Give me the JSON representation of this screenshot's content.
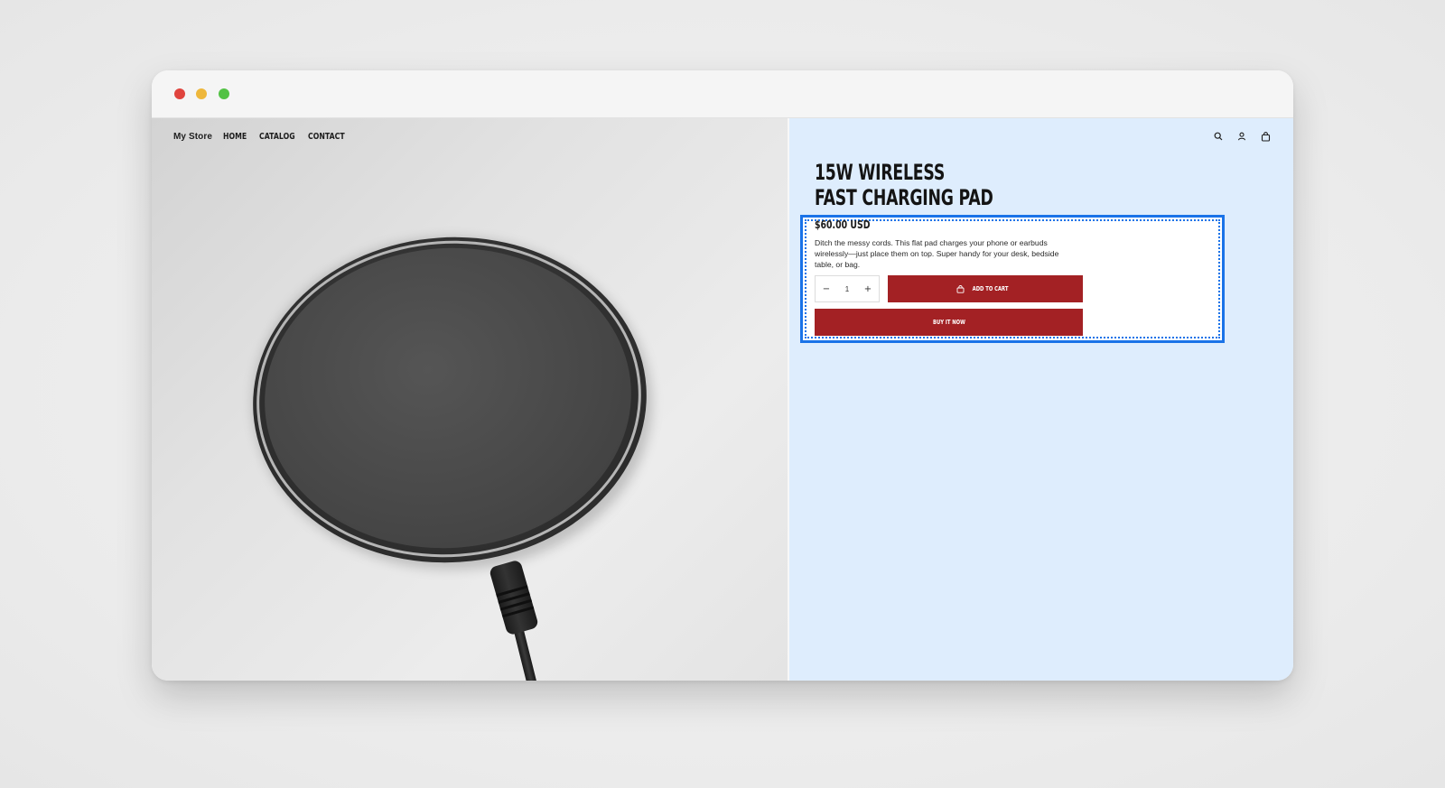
{
  "window": {
    "controls": [
      "close",
      "minimize",
      "maximize"
    ]
  },
  "nav": {
    "brand": "My Store",
    "links": [
      "HOME",
      "CATALOG",
      "CONTACT"
    ]
  },
  "header_icons": [
    "search-icon",
    "account-icon",
    "cart-icon"
  ],
  "product": {
    "title_line1": "15W WIRELESS",
    "title_line2": "FAST CHARGING PAD",
    "price": "$60.00 USD",
    "description": "Ditch the messy cords. This flat pad charges your phone or earbuds wirelessly—just place them on top. Super handy for your desk, bedside table, or bag.",
    "quantity": "1",
    "quantity_decrease": "−",
    "quantity_increase": "+",
    "add_to_cart_label": "ADD TO CART",
    "buy_now_label": "BUY IT NOW"
  },
  "colors": {
    "accent": "#a32124",
    "panel_background": "#deedfd",
    "selection_outline": "#1a73e8"
  }
}
